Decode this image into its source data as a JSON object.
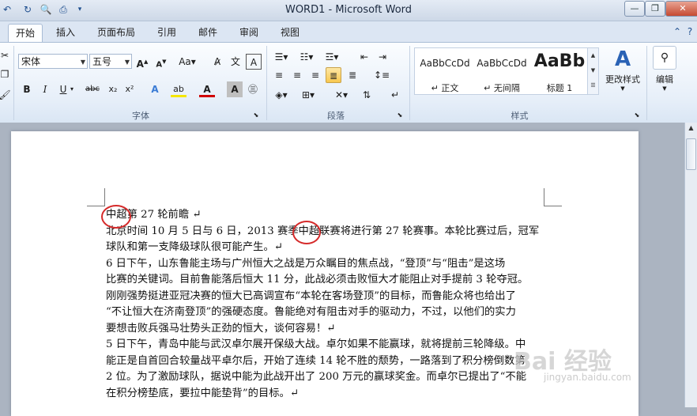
{
  "window": {
    "title": "WORD1 - Microsoft Word"
  },
  "tabs": [
    {
      "label": "开始"
    },
    {
      "label": "插入"
    },
    {
      "label": "页面布局"
    },
    {
      "label": "引用"
    },
    {
      "label": "邮件"
    },
    {
      "label": "审阅"
    },
    {
      "label": "视图"
    }
  ],
  "font_group": {
    "font_name": "宋体",
    "font_size": "五号",
    "label": "字体"
  },
  "paragraph_group": {
    "label": "段落"
  },
  "styles_group": {
    "label": "样式",
    "items": [
      {
        "sample": "AaBbCcDd",
        "name": "正文"
      },
      {
        "sample": "AaBbCcDd",
        "name": "无间隔"
      },
      {
        "sample": "AaBb",
        "name": "标题 1"
      }
    ],
    "change_styles": "更改样式"
  },
  "editing": {
    "label": "编辑"
  },
  "document": {
    "lines": [
      "中超第 27 轮前瞻 ↵",
      "北京时间 10 月 5 日与 6 日，2013 赛季中超联赛将进行第 27 轮赛事。本轮比赛过后，冠军",
      "球队和第一支降级球队很可能产生。↵",
      "6 日下午，山东鲁能主场与广州恒大之战是万众瞩目的焦点战，“登顶”与“阻击”是这场",
      "比赛的关键词。目前鲁能落后恒大 11 分，此战必须击败恒大才能阻止对手提前 3 轮夺冠。",
      "刚刚强势挺进亚冠决赛的恒大已高调宣布“本轮在客场登顶”的目标，而鲁能众将也给出了",
      "“不让恒大在济南登顶”的强硬态度。鲁能绝对有阻击对手的驱动力，不过，以他们的实力",
      "要想击败兵强马壮势头正劲的恒大，谈何容易！↵",
      "5 日下午，青岛中能与武汉卓尔展开保级大战。卓尔如果不能赢球，就将提前三轮降级。中",
      "能正是自首回合较量战平卓尔后，开始了连续 14 轮不胜的颓势，一路落到了积分榜倒数第",
      "2 位。为了激励球队，据说中能为此战开出了 200 万元的赢球奖金。而卓尔已提出了“不能",
      "在积分榜垫底，要拉中能垫背”的目标。↵"
    ]
  },
  "watermark": {
    "main": "Bai 经验",
    "sub": "jingyan.baidu.com"
  },
  "colors": {
    "highlight": "#d52a2a",
    "ribbon_bg": "#e7eff9",
    "active_button": "#f8c84f"
  }
}
